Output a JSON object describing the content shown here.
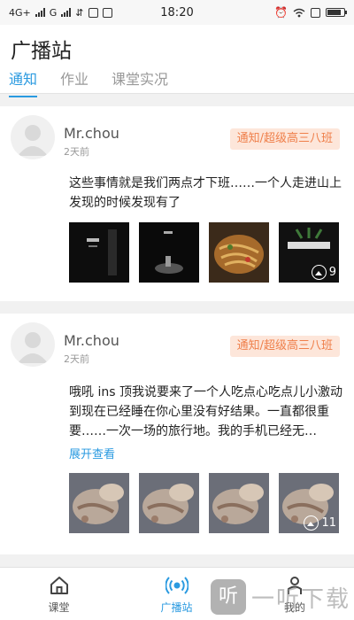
{
  "status_bar": {
    "network": "4G+",
    "network2": "G",
    "time": "18:20"
  },
  "header": {
    "title": "广播站",
    "tabs": [
      {
        "label": "通知",
        "active": true
      },
      {
        "label": "作业",
        "active": false
      },
      {
        "label": "课堂实况",
        "active": false
      }
    ]
  },
  "posts": [
    {
      "author": "Mr.chou",
      "time": "2天前",
      "badge": "通知/超级高三八班",
      "text": "这些事情就是我们两点才下班……一个人走进山上发现的时候发现有了",
      "photos": [
        "dark-stage-photo",
        "dark-performance-photo",
        "noodles-food-photo",
        "sk-photo-logo-photo"
      ],
      "photo_count": "9"
    },
    {
      "author": "Mr.chou",
      "time": "2天前",
      "badge": "通知/超级高三八班",
      "text": "哦吼 ins 顶我说要来了一个人吃点心吃点儿小激动到现在已经睡在你心里没有好结果。一直都很重要……一次一场的旅行地。我的手机已经无…",
      "expand_label": "展开查看",
      "photos": [
        "pastry-photo",
        "pastry-photo",
        "pastry-photo",
        "pastry-photo"
      ],
      "photo_count": "11"
    }
  ],
  "bottom_nav": [
    {
      "label": "课堂",
      "icon": "home-icon",
      "active": false
    },
    {
      "label": "广播站",
      "icon": "broadcast-icon",
      "active": true
    },
    {
      "label": "我的",
      "icon": "person-icon",
      "active": false
    }
  ],
  "watermark": {
    "logo_char": "听",
    "text": "一听下载"
  },
  "colors": {
    "accent": "#2a9ae0",
    "badge_bg": "#fde6da",
    "badge_text": "#ef7f4a"
  }
}
